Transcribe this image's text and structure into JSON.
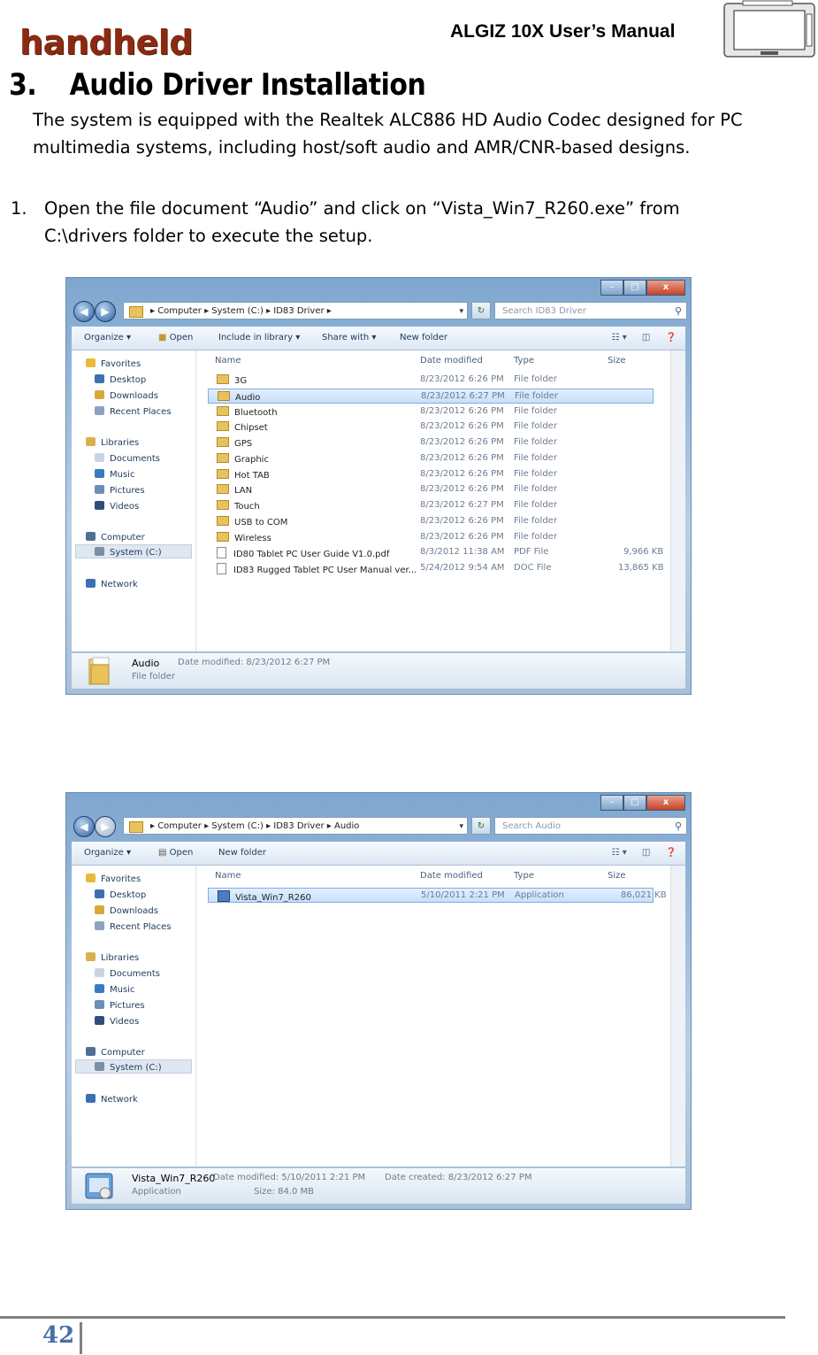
{
  "header": {
    "brand": "handheld",
    "manual_title": "ALGIZ 10X User’s Manual"
  },
  "section": {
    "number": "3.",
    "title": "Audio Driver Installation",
    "intro": "The system is equipped with the Realtek ALC886 HD Audio Codec designed for PC multimedia systems, including host/soft audio and AMR/CNR-based designs."
  },
  "steps": [
    {
      "number": "1.",
      "text": "Open the file document “Audio” and click on “Vista_Win7_R260.exe” from C:\\drivers folder to execute the setup."
    }
  ],
  "window1": {
    "address": "▸ Computer ▸ System (C:) ▸ ID83 Driver ▸",
    "search_placeholder": "Search ID83 Driver",
    "commands": [
      "Organize ▾",
      "Open",
      "Include in library ▾",
      "Share with ▾",
      "New folder"
    ],
    "columns": [
      "Name",
      "Date modified",
      "Type",
      "Size"
    ],
    "nav": [
      "Favorites",
      "Desktop",
      "Downloads",
      "Recent Places",
      "Libraries",
      "Documents",
      "Music",
      "Pictures",
      "Videos",
      "Computer",
      "System (C:)",
      "Network"
    ],
    "files": [
      {
        "name": "3G",
        "date": "8/23/2012 6:26 PM",
        "type": "File folder",
        "size": ""
      },
      {
        "name": "Audio",
        "date": "8/23/2012 6:27 PM",
        "type": "File folder",
        "size": ""
      },
      {
        "name": "Bluetooth",
        "date": "8/23/2012 6:26 PM",
        "type": "File folder",
        "size": ""
      },
      {
        "name": "Chipset",
        "date": "8/23/2012 6:26 PM",
        "type": "File folder",
        "size": ""
      },
      {
        "name": "GPS",
        "date": "8/23/2012 6:26 PM",
        "type": "File folder",
        "size": ""
      },
      {
        "name": "Graphic",
        "date": "8/23/2012 6:26 PM",
        "type": "File folder",
        "size": ""
      },
      {
        "name": "Hot TAB",
        "date": "8/23/2012 6:26 PM",
        "type": "File folder",
        "size": ""
      },
      {
        "name": "LAN",
        "date": "8/23/2012 6:26 PM",
        "type": "File folder",
        "size": ""
      },
      {
        "name": "Touch",
        "date": "8/23/2012 6:27 PM",
        "type": "File folder",
        "size": ""
      },
      {
        "name": "USB to COM",
        "date": "8/23/2012 6:26 PM",
        "type": "File folder",
        "size": ""
      },
      {
        "name": "Wireless",
        "date": "8/23/2012 6:26 PM",
        "type": "File folder",
        "size": ""
      },
      {
        "name": "ID80 Tablet PC User Guide V1.0.pdf",
        "date": "8/3/2012 11:38 AM",
        "type": "PDF File",
        "size": "9,966 KB"
      },
      {
        "name": "ID83 Rugged Tablet PC  User Manual ver...",
        "date": "5/24/2012 9:54 AM",
        "type": "DOC File",
        "size": "13,865 KB"
      }
    ],
    "details": {
      "name": "Audio",
      "meta": "Date modified:  8/23/2012 6:27 PM",
      "type": "File folder"
    }
  },
  "window2": {
    "address": "▸ Computer ▸ System (C:) ▸ ID83 Driver ▸ Audio",
    "search_placeholder": "Search Audio",
    "commands": [
      "Organize ▾",
      "Open",
      "New folder"
    ],
    "columns": [
      "Name",
      "Date modified",
      "Type",
      "Size"
    ],
    "nav": [
      "Favorites",
      "Desktop",
      "Downloads",
      "Recent Places",
      "Libraries",
      "Documents",
      "Music",
      "Pictures",
      "Videos",
      "Computer",
      "System (C:)",
      "Network"
    ],
    "files": [
      {
        "name": "Vista_Win7_R260",
        "date": "5/10/2011 2:21 PM",
        "type": "Application",
        "size": "86,021 KB"
      }
    ],
    "details": {
      "name": "Vista_Win7_R260",
      "modified": "Date modified:  5/10/2011 2:21 PM",
      "created": "Date created:  8/23/2012 6:27 PM",
      "type": "Application",
      "size": "Size:  84.0 MB"
    }
  },
  "footer": {
    "page_number": "42"
  }
}
